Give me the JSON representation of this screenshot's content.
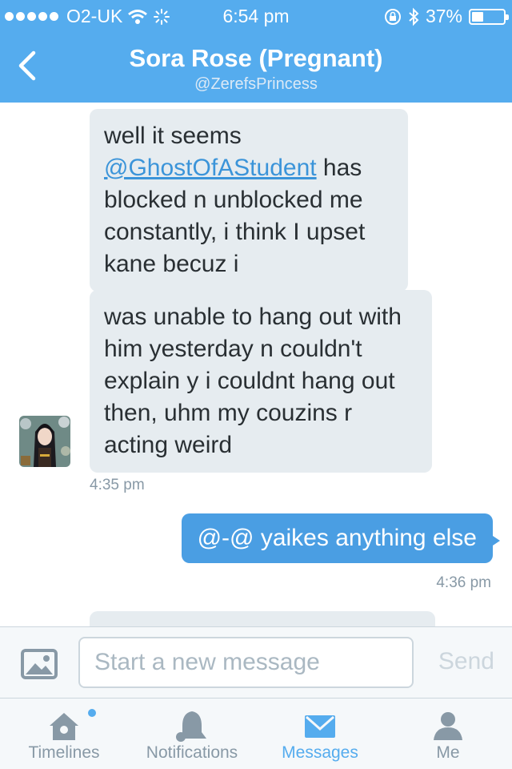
{
  "status_bar": {
    "carrier": "O2-UK",
    "time": "6:54 pm",
    "battery_text": "37%",
    "battery_level": 0.37
  },
  "nav": {
    "title": "Sora Rose (Pregnant)",
    "handle": "@ZerefsPrincess"
  },
  "messages": {
    "incoming_1": {
      "line1_pre": "well it seems",
      "mention": "@GhostOfAStudent",
      "line2_post": " has",
      "rest": "blocked n unblocked me constantly, i think I upset kane becuz i"
    },
    "incoming_2": {
      "text": "was unable to hang out with him yesterday n couldn't explain y i couldnt hang out then,  uhm my couzins r acting weird"
    },
    "incoming_time": "4:35 pm",
    "outgoing_1": {
      "text": "@-@ yaikes anything else"
    },
    "outgoing_time": "4:36 pm"
  },
  "composer": {
    "placeholder": "Start a new message",
    "send_label": "Send"
  },
  "tabs": [
    {
      "label": "Timelines",
      "icon": "home-icon"
    },
    {
      "label": "Notifications",
      "icon": "bell-icon"
    },
    {
      "label": "Messages",
      "icon": "envelope-icon"
    },
    {
      "label": "Me",
      "icon": "person-icon"
    }
  ],
  "colors": {
    "header": "#55acee",
    "incoming_bubble": "#e6ecf0",
    "outgoing_bubble": "#4a9ee3",
    "active_tab": "#55acee",
    "inactive": "#8899a6"
  }
}
